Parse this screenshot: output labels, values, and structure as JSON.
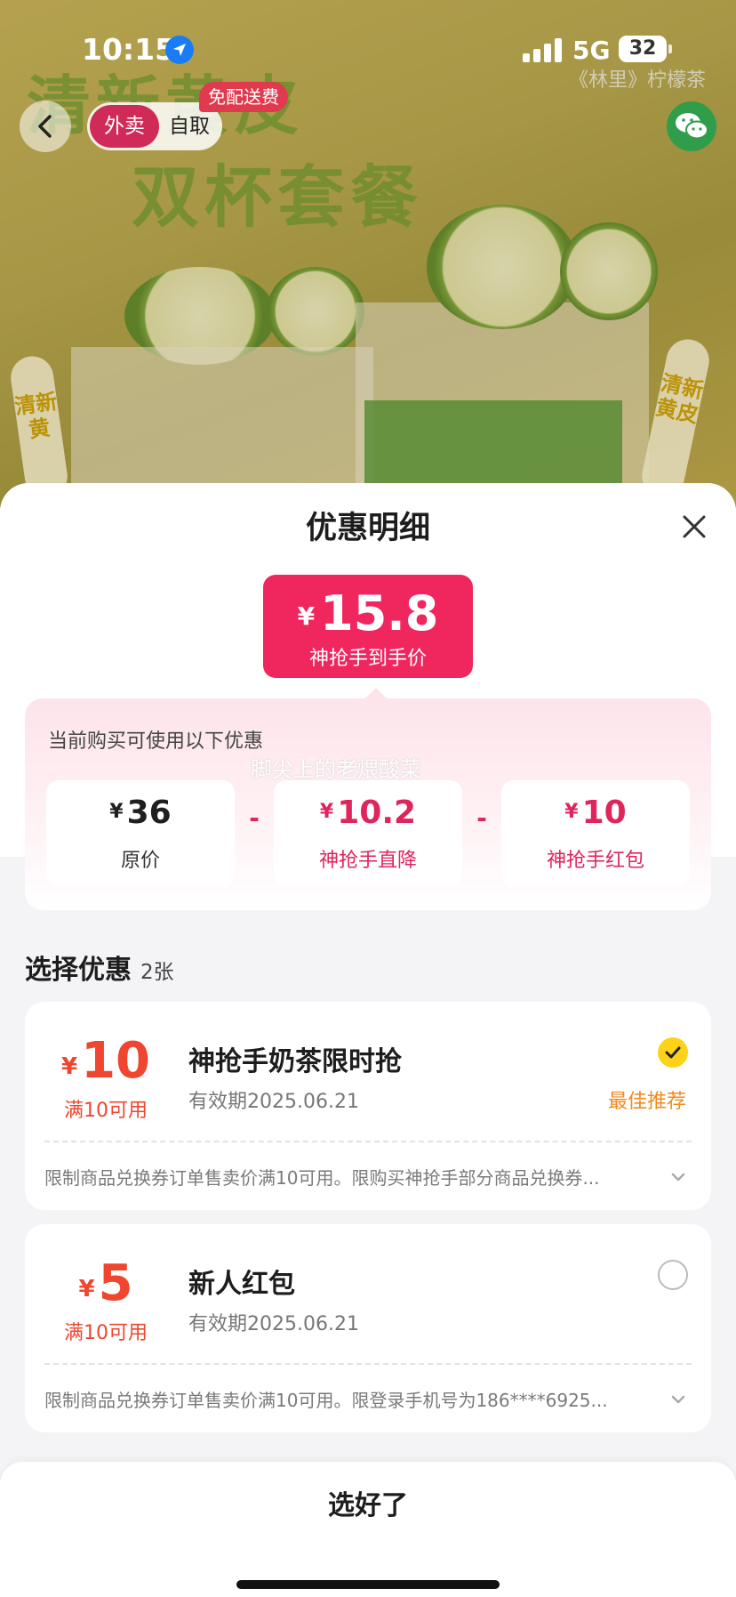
{
  "status_bar": {
    "time": "10:15",
    "network": "5G",
    "battery": "32"
  },
  "background": {
    "headline_1": "清新黄皮",
    "headline_2": "双杯套餐",
    "brand": "《林里》柠檬茶",
    "side_tag_1": "清新黄",
    "side_tag_2": "清新黄皮"
  },
  "nav": {
    "mode_delivery": "外卖",
    "mode_pickup": "自取",
    "free_delivery_badge": "免配送费"
  },
  "sheet": {
    "title": "优惠明细",
    "final_price": {
      "currency": "¥",
      "amount": "15.8",
      "label": "神抢手到手价"
    },
    "panel_caption": "当前购买可使用以下优惠",
    "watermark": "脚尖上的老煨酸菜",
    "breakdown": [
      {
        "currency": "¥",
        "value": "36",
        "label": "原价"
      },
      {
        "currency": "¥",
        "value": "10.2",
        "label": "神抢手直降"
      },
      {
        "currency": "¥",
        "value": "10",
        "label": "神抢手红包"
      }
    ],
    "operator": "-",
    "select_title": "选择优惠",
    "select_count": "2张",
    "coupons": [
      {
        "currency": "¥",
        "amount": "10",
        "condition": "满10可用",
        "name": "神抢手奶茶限时抢",
        "expiry": "有效期2025.06.21",
        "selected": true,
        "badge": "最佳推荐",
        "description": "限制商品兑换券订单售卖价满10可用。限购买神抢手部分商品兑换券..."
      },
      {
        "currency": "¥",
        "amount": "5",
        "condition": "满10可用",
        "name": "新人红包",
        "expiry": "有效期2025.06.21",
        "selected": false,
        "badge": "",
        "description": "限制商品兑换券订单售卖价满10可用。限登录手机号为186****6925..."
      }
    ],
    "confirm_label": "选好了"
  },
  "colors": {
    "accent_pink": "#f0265e",
    "coupon_orange": "#f0452e",
    "best_orange": "#f08a1c",
    "check_yellow": "#ffd21a"
  },
  "icons": [
    "location-arrow-icon",
    "signal-icon",
    "battery-icon",
    "back-arrow-icon",
    "wechat-icon",
    "close-icon",
    "check-icon",
    "chevron-down-icon"
  ]
}
